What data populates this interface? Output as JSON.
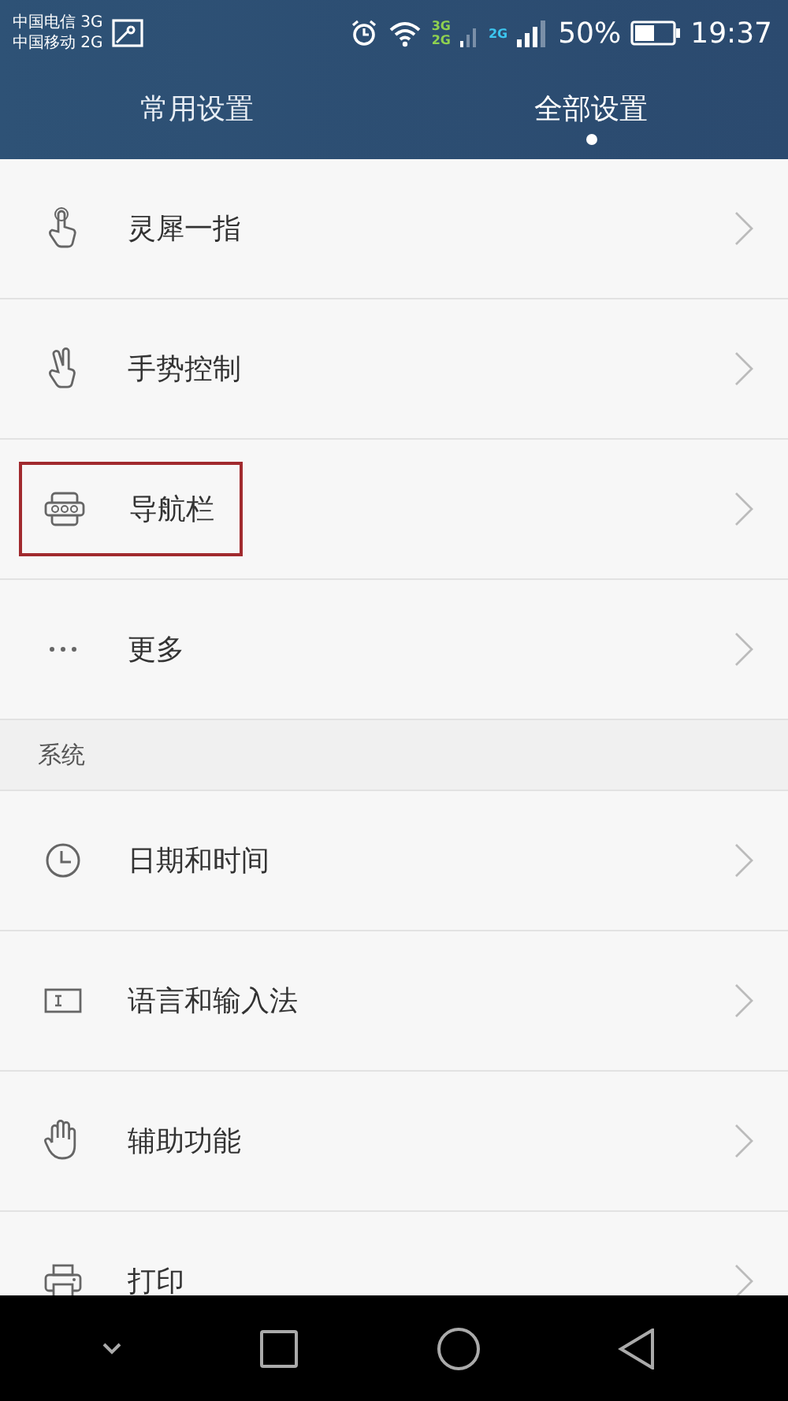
{
  "status_bar": {
    "carriers": [
      "中国电信 3G",
      "中国移动 2G"
    ],
    "network_labels": [
      "3G",
      "2G",
      "2G"
    ],
    "battery": "50%",
    "time": "19:37"
  },
  "tabs": [
    {
      "label": "常用设置",
      "selected": false
    },
    {
      "label": "全部设置",
      "selected": true
    }
  ],
  "sections": [
    {
      "items": [
        {
          "label": "灵犀一指",
          "highlighted": false
        },
        {
          "label": "手势控制",
          "highlighted": false
        },
        {
          "label": "导航栏",
          "highlighted": true
        },
        {
          "label": "更多",
          "highlighted": false
        }
      ]
    },
    {
      "header": "系统",
      "items": [
        {
          "label": "日期和时间",
          "highlighted": false
        },
        {
          "label": "语言和输入法",
          "highlighted": false
        },
        {
          "label": "辅助功能",
          "highlighted": false
        },
        {
          "label": "打印",
          "highlighted": false
        }
      ]
    }
  ]
}
